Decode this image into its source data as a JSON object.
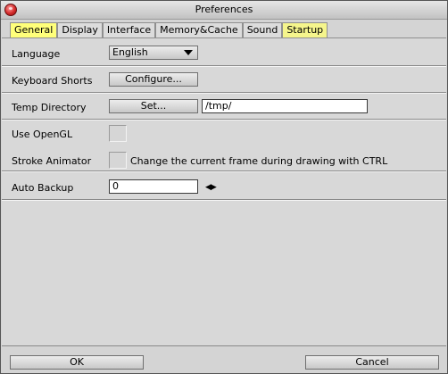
{
  "window": {
    "title": "Preferences"
  },
  "tabs": [
    {
      "label": "General",
      "active": true
    },
    {
      "label": "Display"
    },
    {
      "label": "Interface"
    },
    {
      "label": "Memory&Cache"
    },
    {
      "label": "Sound"
    },
    {
      "label": "Startup"
    }
  ],
  "general": {
    "language": {
      "label": "Language",
      "value": "English"
    },
    "keyboard": {
      "label": "Keyboard Shorts",
      "button": "Configure..."
    },
    "temp_dir": {
      "label": "Temp Directory",
      "button": "Set...",
      "value": "/tmp/"
    },
    "opengl": {
      "label": "Use OpenGL",
      "checked": false
    },
    "stroke": {
      "label": "Stroke Animator",
      "checked": false,
      "description": "Change the current frame during drawing with CTRL"
    },
    "backup": {
      "label": "Auto Backup",
      "value": "0",
      "spin": "◀▶"
    }
  },
  "footer": {
    "ok": "OK",
    "cancel": "Cancel"
  },
  "colors": {
    "active_tab": "#ffff7a",
    "panel": "#d8d8d8",
    "close": "#d42a2a"
  }
}
